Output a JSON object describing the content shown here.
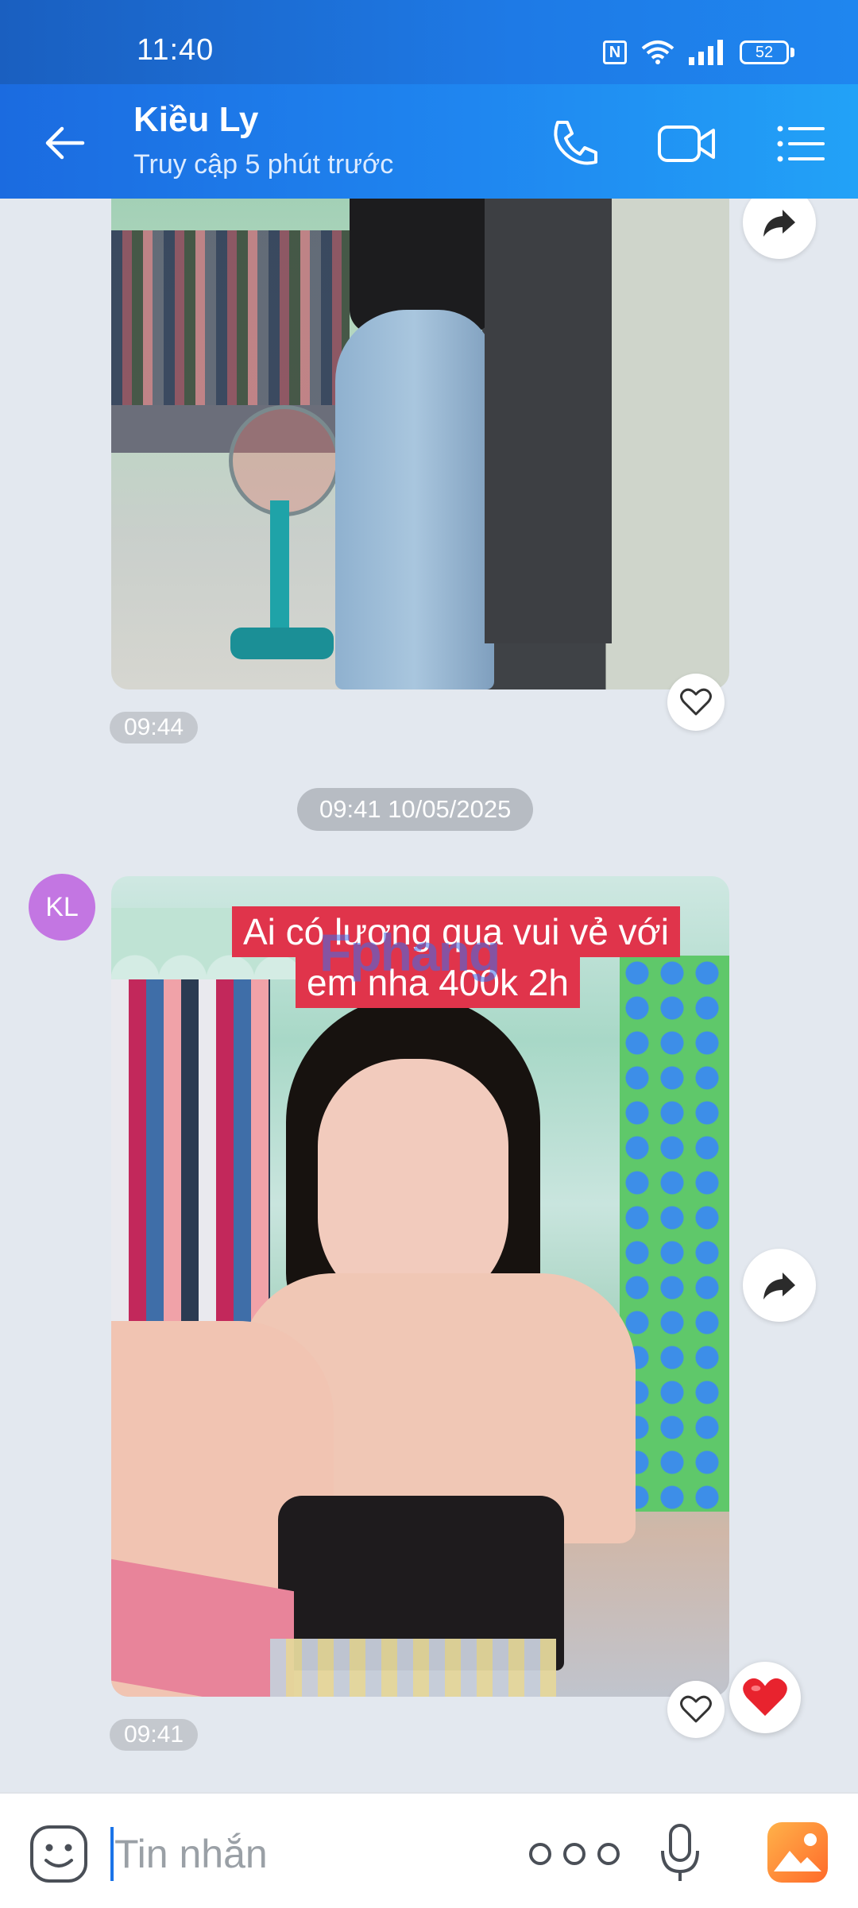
{
  "status_bar": {
    "time": "11:40",
    "battery": "52",
    "icons": [
      "nfc-icon",
      "wifi-icon",
      "signal-icon",
      "battery-icon"
    ]
  },
  "header": {
    "contact_name": "Kiều Ly",
    "contact_status": "Truy cập 5 phút trước",
    "icons": [
      "back-arrow-icon",
      "phone-icon",
      "video-camera-icon",
      "menu-list-icon"
    ]
  },
  "messages": [
    {
      "type": "image",
      "time": "09:44",
      "description_icons": [
        "forward-icon",
        "heart-outline-icon"
      ]
    },
    {
      "type": "date-separator",
      "label": "09:41 10/05/2025"
    },
    {
      "type": "image",
      "sender_initials": "KL",
      "caption_lines": [
        "Ai có lương qua vui vẻ với",
        "em nha 400k 2h"
      ],
      "watermark": "Fphang",
      "time": "09:41",
      "reaction": "heart"
    }
  ],
  "input_bar": {
    "placeholder": "Tin nhắn",
    "icons": [
      "sticker-icon",
      "more-dots-icon",
      "microphone-icon",
      "image-gallery-icon"
    ]
  },
  "colors": {
    "header_start": "#1b6be0",
    "header_end": "#22a2f7",
    "chat_background": "#e3e8ef",
    "avatar": "#c376e2",
    "caption_background": "#e0344b",
    "reaction_heart": "#e8232e",
    "image_button": "#ff8a3d"
  }
}
